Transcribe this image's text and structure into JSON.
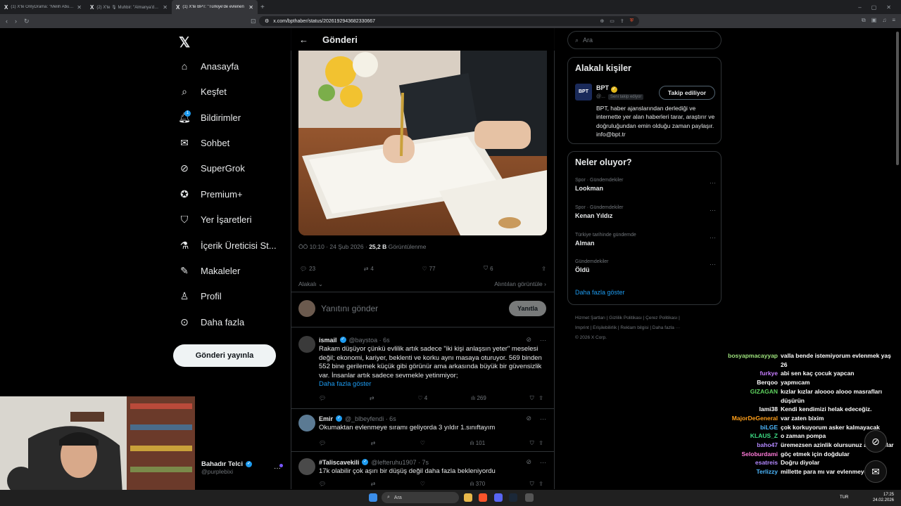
{
  "browser": {
    "tabs": [
      {
        "title": "(1) X'te OnlyDrama: \"Melih Abuaf, Yı",
        "active": false
      },
      {
        "title": "(2) X'te 🎙 Muhbir: \"Almanya'dan Tü",
        "active": false
      },
      {
        "title": "(1) X'te BPT: \"Türkiye'de evlenen",
        "active": true
      }
    ],
    "url": "x.com/bpthaber/status/2026192943682330667"
  },
  "nav": {
    "items": [
      {
        "label": "Anasayfa",
        "icon": "home-icon"
      },
      {
        "label": "Keşfet",
        "icon": "search-icon"
      },
      {
        "label": "Bildirimler",
        "icon": "bell-icon"
      },
      {
        "label": "Sohbet",
        "icon": "mail-icon"
      },
      {
        "label": "SuperGrok",
        "icon": "grok-icon"
      },
      {
        "label": "Premium+",
        "icon": "premium-icon"
      },
      {
        "label": "Yer İşaretleri",
        "icon": "bookmark-icon"
      },
      {
        "label": "İçerik Üreticisi St...",
        "icon": "flask-icon"
      },
      {
        "label": "Makaleler",
        "icon": "article-icon"
      },
      {
        "label": "Profil",
        "icon": "person-icon"
      },
      {
        "label": "Daha fazla",
        "icon": "more-icon"
      }
    ],
    "notif_count": "1",
    "post_button": "Gönderi yayınla"
  },
  "post": {
    "header": "Gönderi",
    "time": "ÖÖ 10:10 · 24 Şub 2026 ·",
    "views": "25,2 B",
    "views_label": "Görüntülenme",
    "replies": "23",
    "retweets": "4",
    "likes": "77",
    "bookmarks": "6",
    "sort": "Alakalı",
    "quotes_link": "Alıntılan görüntüle",
    "reply_placeholder": "Yanıtını gönder",
    "reply_button": "Yanıtla"
  },
  "replies": [
    {
      "name": "ismail",
      "handle": "@baystoa · 6s",
      "text": "Rakam düşüyor çünkü evlilik artık sadece \"iki kişi anlaşsın yeter\" meselesi değil; ekonomi, kariyer, beklenti ve korku aynı masaya oturuyor. 569 binden 552 bine gerilemek küçük gibi görünür ama arkasında büyük bir güvensizlik var. İnsanlar artık sadece sevmekle yetinmiyor;",
      "more": "Daha fazla göster",
      "likes": "4",
      "views": "269"
    },
    {
      "name": "Emir",
      "handle": "@_blbeyfendi · 6s",
      "text": "Okumaktan evlenmeye sıramı geliyorda 3 yıldır 1.sınıftayım",
      "views": "101"
    },
    {
      "name": "#Taliscavekili",
      "handle": "@lefteruhu1907 · 7s",
      "text": "17k olabilir çok aşırı bir düşüş değil daha fazla bekleniyordu",
      "views": "370"
    }
  ],
  "right": {
    "search_placeholder": "Ara",
    "related_title": "Alakalı kişiler",
    "account": {
      "name": "BPT",
      "handle": "@...",
      "follows_you": "Seni takip ediyor",
      "button": "Takip ediliyor",
      "bio": "BPT, haber ajanslarından derlediği ve internette yer alan haberleri tarar, araştırır ve doğruluğundan emin olduğu zaman paylaşır. info@bpt.tr"
    },
    "trends_title": "Neler oluyor?",
    "trends": [
      {
        "context": "Spor · Gündemdekiler",
        "name": "Lookman"
      },
      {
        "context": "Spor · Gündemdekiler",
        "name": "Kenan Yıldız"
      },
      {
        "context": "Türkiye tarihinde gündemde",
        "name": "Alman"
      },
      {
        "context": "Gündemdekiler",
        "name": "Öldü"
      }
    ],
    "show_more": "Daha fazla göster",
    "footer1": "Hizmet Şartları  |  Gizlilik Politikası  |  Çerez Politikası  |",
    "footer2": "Imprint  |  Erişilebilirlik  |  Reklam bilgisi  |  Daha fazla ···",
    "footer3": "© 2026 X Corp."
  },
  "streamer": {
    "name": "Bahadır Telci",
    "handle": "@purplebixi"
  },
  "chat": [
    {
      "user": "bosyapmacayyap",
      "color": "#9ee37d",
      "msg": "valla bende istemiyorum evlenmek yaş 26"
    },
    {
      "user": "furkye",
      "color": "#c77dff",
      "msg": "abi sen kaç çocuk yapcan"
    },
    {
      "user": "Berqoo",
      "color": "#ffffff",
      "msg": "yapmıcam"
    },
    {
      "user": "GIZAGAN",
      "color": "#5fd35f",
      "msg": "kızlar kızlar aloooo alooo masrafları düşürün"
    },
    {
      "user": "lami38",
      "color": "#ffffff",
      "msg": "Kendi kendimizi helak edeceğiz."
    },
    {
      "user": "MajorDeGeneral",
      "color": "#ff9f1a",
      "msg": "var zaten bixim"
    },
    {
      "user": "biLGE",
      "color": "#4db8ff",
      "msg": "çok korkuyorum asker kalmayacak"
    },
    {
      "user": "KLAUS_Z",
      "color": "#3ddc84",
      "msg": "o zaman pompa"
    },
    {
      "user": "baho47",
      "color": "#b388ff",
      "msg": "üremezsen azinlik olursunuz arkadaslar"
    },
    {
      "user": "Seloburdami",
      "color": "#ff7ad9",
      "msg": "göç etmek için doğdular"
    },
    {
      "user": "esatreis",
      "color": "#b388ff",
      "msg": "Doğru diyolar"
    },
    {
      "user": "Terlizzy",
      "color": "#4db8ff",
      "msg": "millette para mı var evlenmeye"
    }
  ],
  "taskbar": {
    "search": "Ara",
    "lang": "TUR",
    "time": "17:25",
    "date": "24.02.2026"
  }
}
